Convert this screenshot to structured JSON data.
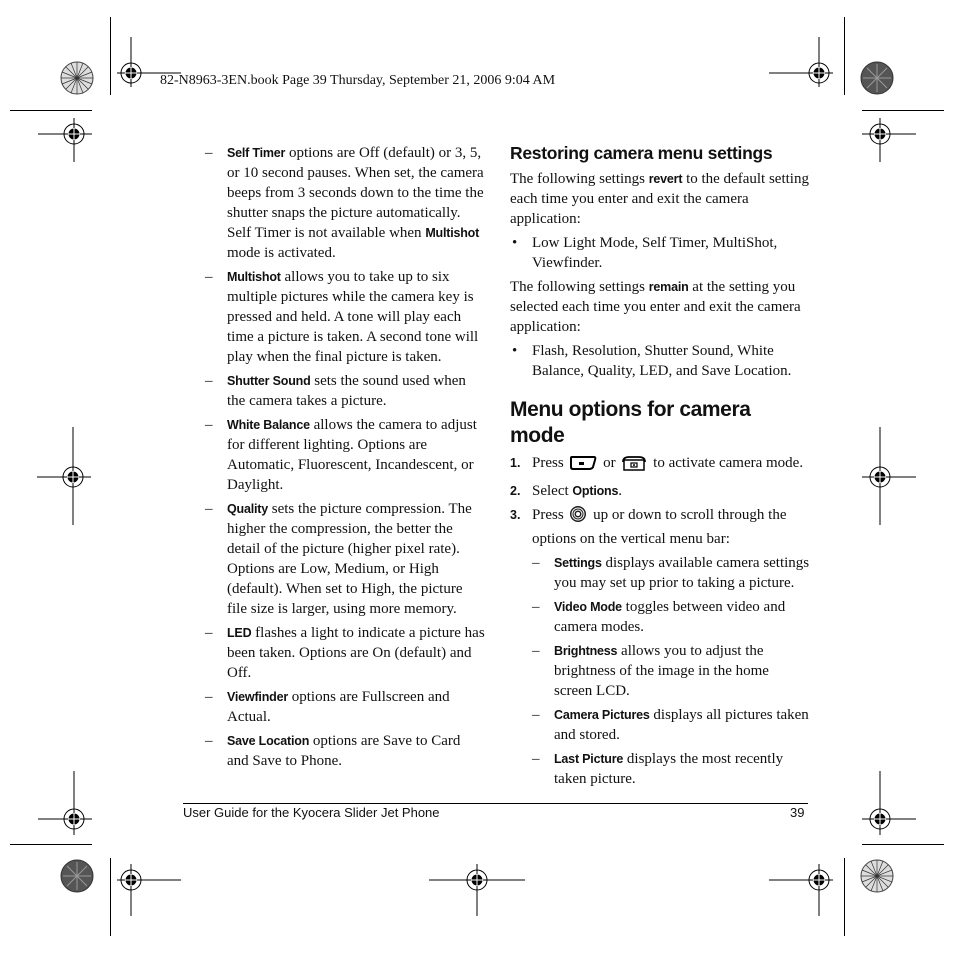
{
  "slug": "82-N8963-3EN.book  Page 39  Thursday, September 21, 2006  9:04 AM",
  "left_column": {
    "items": [
      {
        "term": "Self Timer",
        "text": " options are Off (default) or 3, 5, or 10 second pauses. When set, the camera beeps from 3 seconds down to the time the shutter snaps the picture automatically. Self Timer is not available when ",
        "term2": "Multishot",
        "text2": " mode is activated."
      },
      {
        "term": "Multishot",
        "text": " allows you to take up to six multiple pictures while the camera key is pressed and held. A tone will play each time a picture is taken. A second tone will play when the final picture is taken."
      },
      {
        "term": "Shutter Sound",
        "text": " sets the sound used when the camera takes a picture."
      },
      {
        "term": "White Balance",
        "text": " allows the camera to adjust for different lighting. Options are Automatic, Fluorescent, Incandescent, or Daylight."
      },
      {
        "term": "Quality",
        "text": " sets the picture compression. The higher the compression, the better the detail of the picture (higher pixel rate). Options are Low, Medium, or High (default). When set to High, the picture file size is larger, using more memory."
      },
      {
        "term": "LED",
        "text": " flashes a light to indicate a picture has been taken. Options are On (default) and Off."
      },
      {
        "term": "Viewfinder",
        "text": " options are Fullscreen and Actual."
      },
      {
        "term": "Save Location",
        "text": " options are Save to Card and Save to Phone."
      }
    ],
    "dash": "–"
  },
  "right_column": {
    "restoring": {
      "heading": "Restoring camera menu settings",
      "para1_pre": "The following settings ",
      "para1_kw": "revert",
      "para1_post": " to the default setting each time you enter and exit the camera application:",
      "bullet1": "Low Light Mode, Self Timer, MultiShot, Viewfinder.",
      "para2_pre": "The following settings ",
      "para2_kw": "remain",
      "para2_post": " at the setting you selected each time you enter and exit the camera application:",
      "bullet2": "Flash, Resolution, Shutter Sound, White Balance, Quality, LED, and Save Location.",
      "bullet_char": "•"
    },
    "menu_options": {
      "heading": "Menu options for camera mode",
      "steps": [
        {
          "num": "1.",
          "pre": "Press ",
          "icon1": "camera-side-key-icon",
          "mid": " or ",
          "icon2": "camera-key-icon",
          "post": " to activate camera mode."
        },
        {
          "num": "2.",
          "pre": "Select ",
          "kw": "Options",
          "post": "."
        },
        {
          "num": "3.",
          "pre": "Press ",
          "icon": "navigation-key-icon",
          "post": " up or down to scroll through the options on the vertical menu bar:"
        }
      ],
      "subitems": [
        {
          "term": "Settings",
          "text": " displays available camera settings you may set up prior to taking a picture."
        },
        {
          "term": "Video Mode",
          "text": " toggles between video and camera modes."
        },
        {
          "term": "Brightness",
          "text": " allows you to adjust the brightness of the image in the home screen LCD."
        },
        {
          "term": "Camera Pictures",
          "text": " displays all pictures taken and stored."
        },
        {
          "term": "Last Picture",
          "text": " displays the most recently taken picture."
        }
      ]
    }
  },
  "footer": {
    "title": "User Guide for the Kyocera Slider Jet Phone",
    "page_number": "39"
  }
}
